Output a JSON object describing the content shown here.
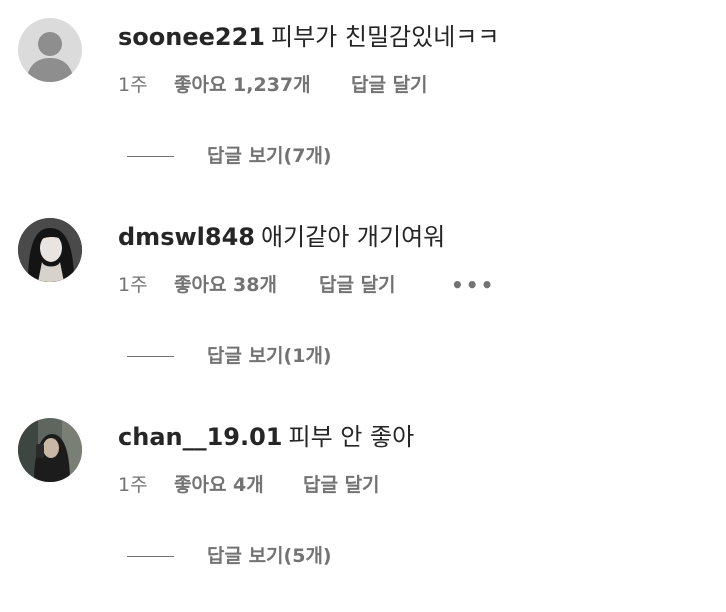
{
  "comments": [
    {
      "username": "soonee221",
      "text": "피부가 친밀감있네ㅋㅋ",
      "time": "1주",
      "likes": "좋아요 1,237개",
      "reply": "답글 달기",
      "more": "",
      "view_replies": "답글 보기(7개)",
      "avatar": "default-avatar-icon"
    },
    {
      "username": "dmswl848",
      "text": "애기같아 개기여워",
      "time": "1주",
      "likes": "좋아요 38개",
      "reply": "답글 달기",
      "more": "•••",
      "view_replies": "답글 보기(1개)",
      "avatar": "photo-avatar"
    },
    {
      "username": "chan__19.01",
      "text": "피부 안 좋아",
      "time": "1주",
      "likes": "좋아요 4개",
      "reply": "답글 달기",
      "more": "",
      "view_replies": "답글 보기(5개)",
      "avatar": "photo-avatar"
    }
  ],
  "colors": {
    "text_primary": "#262626",
    "text_secondary": "#737373",
    "background": "#ffffff",
    "default_avatar_bg": "#dbdbdb"
  }
}
